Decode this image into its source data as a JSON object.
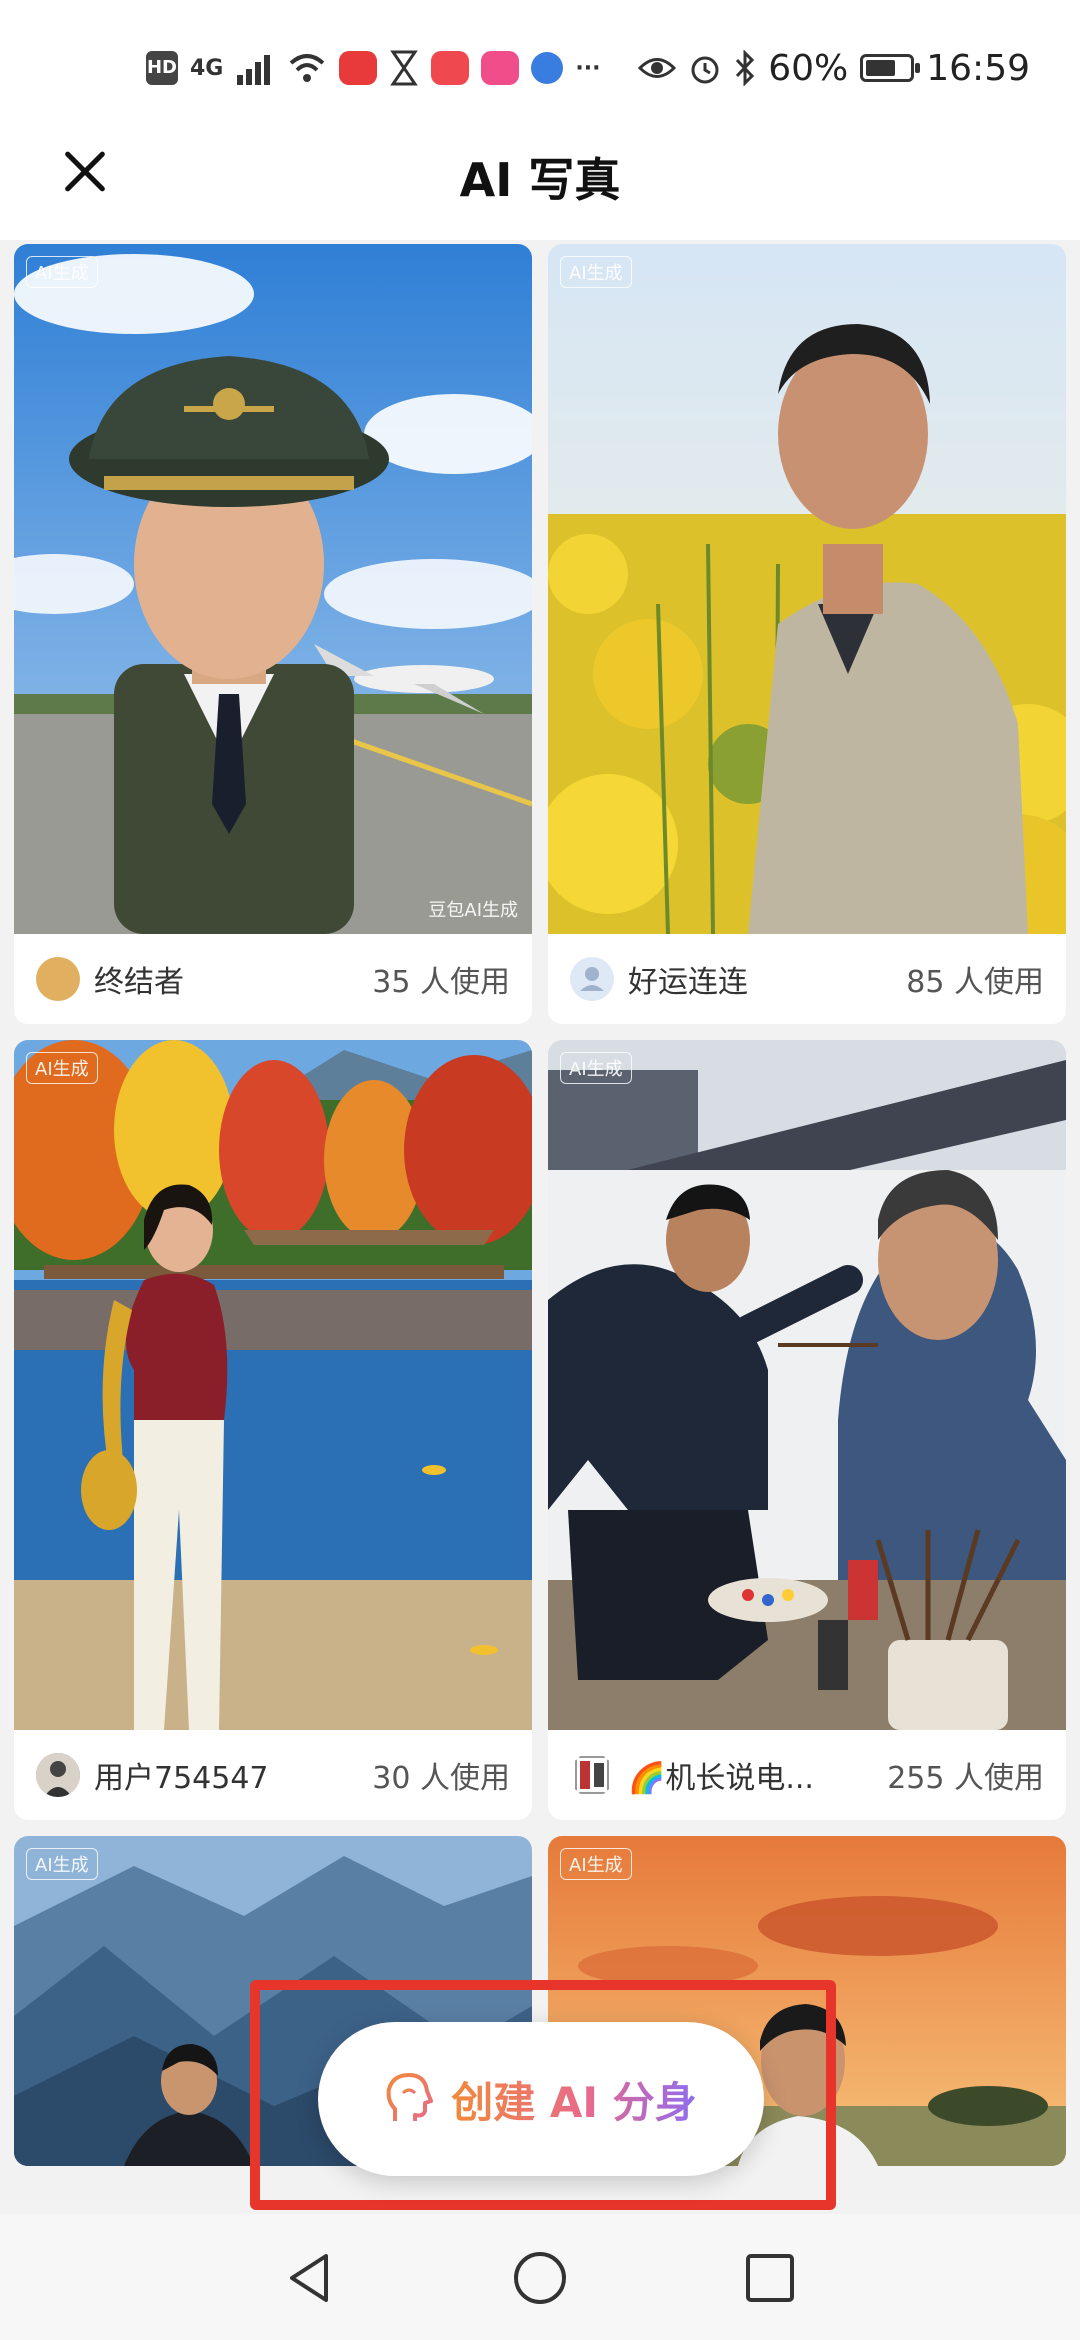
{
  "status_bar": {
    "network": "4G",
    "hd": "HD",
    "dots": "···",
    "battery": "60%",
    "time": "16:59",
    "icons": [
      "hd-icon",
      "signal-icon",
      "wifi-icon",
      "app-icon",
      "hourglass-icon",
      "app-icon",
      "app-icon",
      "app-icon",
      "eye-icon",
      "alarm-icon",
      "bluetooth-icon",
      "battery-icon"
    ]
  },
  "header": {
    "title": "AI 写真"
  },
  "cards": [
    {
      "author": "终结者",
      "uses": "35 人使用",
      "tag": "AI生成",
      "watermark": "豆包AI生成",
      "avatar_color": "#e0b060"
    },
    {
      "author": "好运连连",
      "uses": "85 人使用",
      "tag": "AI生成",
      "avatar_color": "#dfe8f5"
    },
    {
      "author": "用户754547",
      "uses": "30 人使用",
      "tag": "AI生成",
      "avatar_color": "#8a8a8a"
    },
    {
      "author": "🌈机长说电...",
      "uses": "255 人使用",
      "tag": "AI生成",
      "avatar_color": "#ffffff"
    },
    {
      "tag": "AI生成"
    },
    {
      "tag": "AI生成"
    }
  ],
  "create_button": {
    "label": "创建 AI 分身"
  },
  "colors": {
    "highlight": "#e8352b",
    "gradient_start": "#f08a3a",
    "gradient_end": "#8f6cf0"
  }
}
